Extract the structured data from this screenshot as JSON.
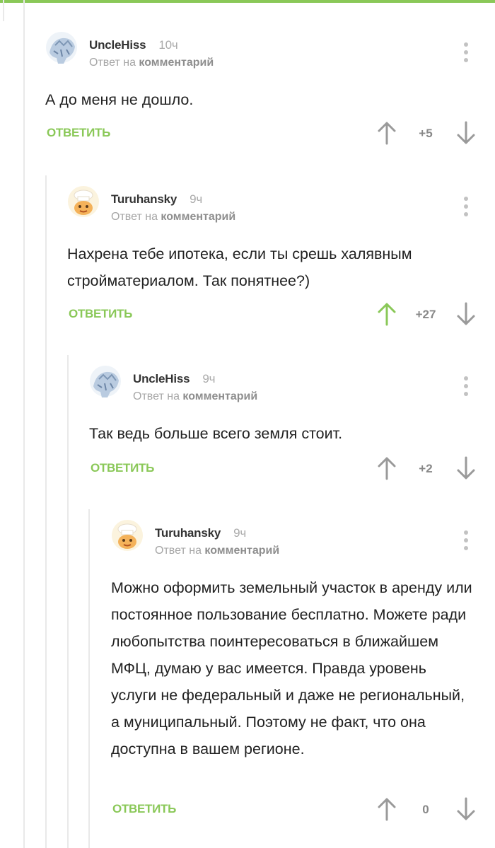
{
  "comments": [
    {
      "author": "UncleHiss",
      "time": "10ч",
      "reply_prefix": "Ответ на",
      "reply_target": "комментарий",
      "text": "А до меня не дошло.",
      "reply_label": "ОТВЕТИТЬ",
      "score": "+5",
      "avatar": "ice-creature-avatar",
      "upvoted": false
    },
    {
      "author": "Turuhansky",
      "time": "9ч",
      "reply_prefix": "Ответ на",
      "reply_target": "комментарий",
      "text": "Нахрена тебе ипотека, если ты срешь халявным стройматериалом. Так понятнее?)",
      "reply_label": "ОТВЕТИТЬ",
      "score": "+27",
      "avatar": "chef-avatar",
      "upvoted": true
    },
    {
      "author": "UncleHiss",
      "time": "9ч",
      "reply_prefix": "Ответ на",
      "reply_target": "комментарий",
      "text": "Так ведь больше всего земля стоит.",
      "reply_label": "ОТВЕТИТЬ",
      "score": "+2",
      "avatar": "ice-creature-avatar",
      "upvoted": false
    },
    {
      "author": "Turuhansky",
      "time": "9ч",
      "reply_prefix": "Ответ на",
      "reply_target": "комментарий",
      "text": "Можно оформить земельный участок в аренду или постоянное пользование бесплатно. Можете ради любопытства поинтересоваться в ближайшем МФЦ, думаю у вас имеется. Правда уровень услуги не федеральный и даже не региональный, а муниципальный. Поэтому не факт, что она доступна в вашем регионе.",
      "reply_label": "ОТВЕТИТЬ",
      "score": "0",
      "avatar": "chef-avatar",
      "upvoted": false
    }
  ],
  "colors": {
    "accent": "#8ac858",
    "muted": "#a6a6a6",
    "arrow": "#9a9a9a",
    "thread_line": "#e9e9e9"
  }
}
